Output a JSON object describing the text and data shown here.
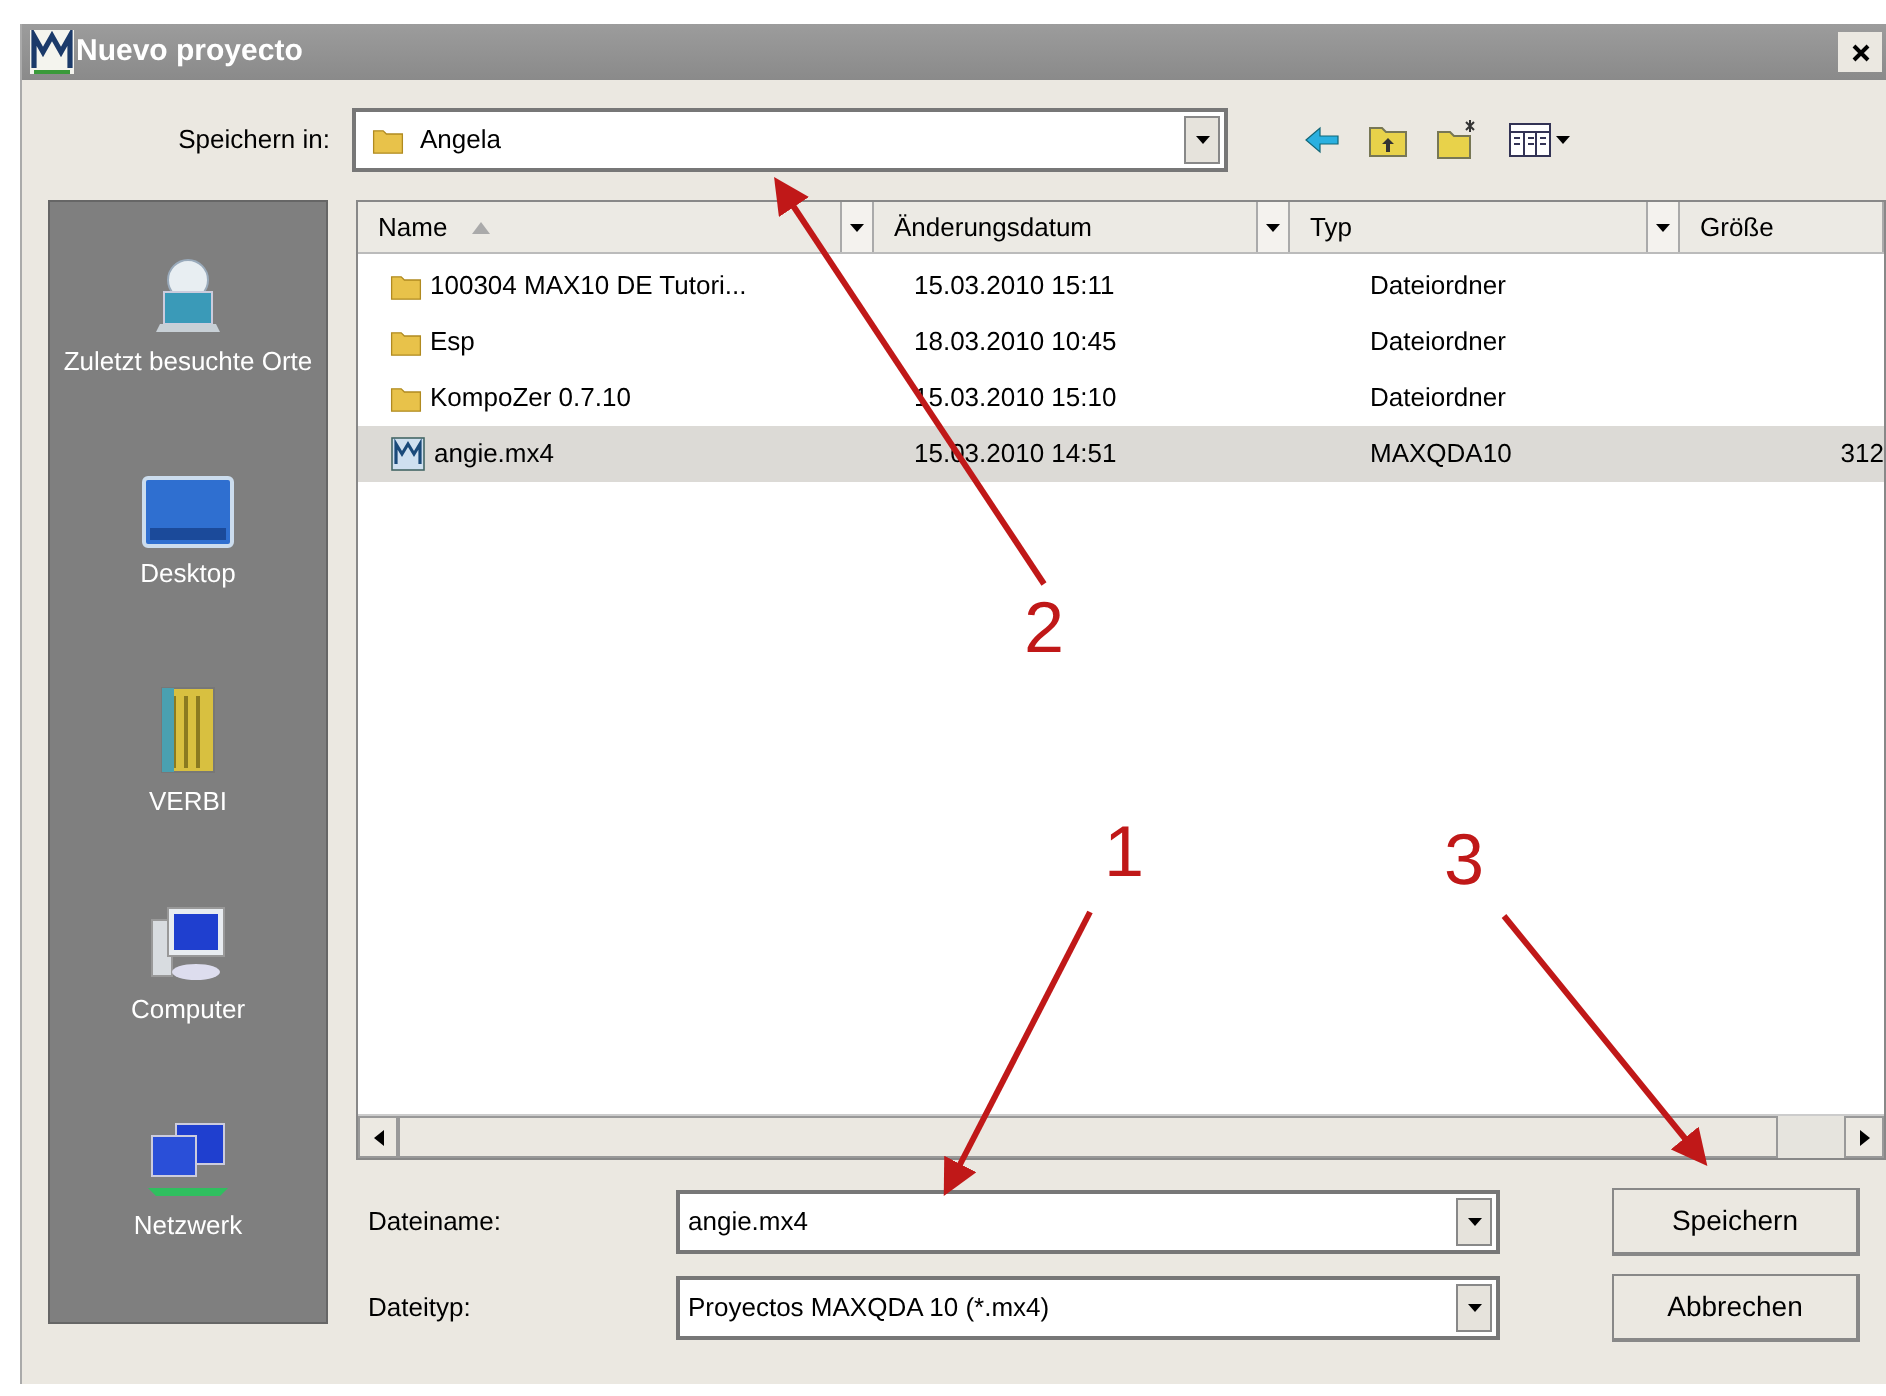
{
  "window": {
    "title": "Nuevo proyecto"
  },
  "save_in": {
    "label": "Speichern in:",
    "value": "Angela"
  },
  "places": [
    {
      "label": "Zuletzt besuchte Orte",
      "kind": "recent"
    },
    {
      "label": "Desktop",
      "kind": "desktop"
    },
    {
      "label": "VERBI",
      "kind": "library"
    },
    {
      "label": "Computer",
      "kind": "computer"
    },
    {
      "label": "Netzwerk",
      "kind": "network"
    }
  ],
  "columns": [
    {
      "label": "Name",
      "sorted": true
    },
    {
      "label": "Änderungsdatum",
      "sorted": false
    },
    {
      "label": "Typ",
      "sorted": false
    },
    {
      "label": "Größe",
      "sorted": false
    }
  ],
  "rows": [
    {
      "kind": "folder",
      "name": "100304 MAX10 DE Tutori...",
      "date": "15.03.2010 15:11",
      "type": "Dateiordner",
      "selected": false
    },
    {
      "kind": "folder",
      "name": "Esp",
      "date": "18.03.2010 10:45",
      "type": "Dateiordner",
      "selected": false
    },
    {
      "kind": "folder",
      "name": "KompoZer 0.7.10",
      "date": "15.03.2010 15:10",
      "type": "Dateiordner",
      "selected": false
    },
    {
      "kind": "project",
      "name": "angie.mx4",
      "date": "15.03.2010 14:51",
      "type": "MAXQDA10",
      "size": "312",
      "selected": true
    }
  ],
  "file_name": {
    "label": "Dateiname:",
    "value": "angie.mx4"
  },
  "file_type": {
    "label": "Dateityp:",
    "value": "Proyectos MAXQDA 10 (*.mx4)"
  },
  "buttons": [
    "Speichern",
    "Abbrechen"
  ],
  "annotations": [
    {
      "label": "1"
    },
    {
      "label": "2"
    },
    {
      "label": "3"
    }
  ]
}
